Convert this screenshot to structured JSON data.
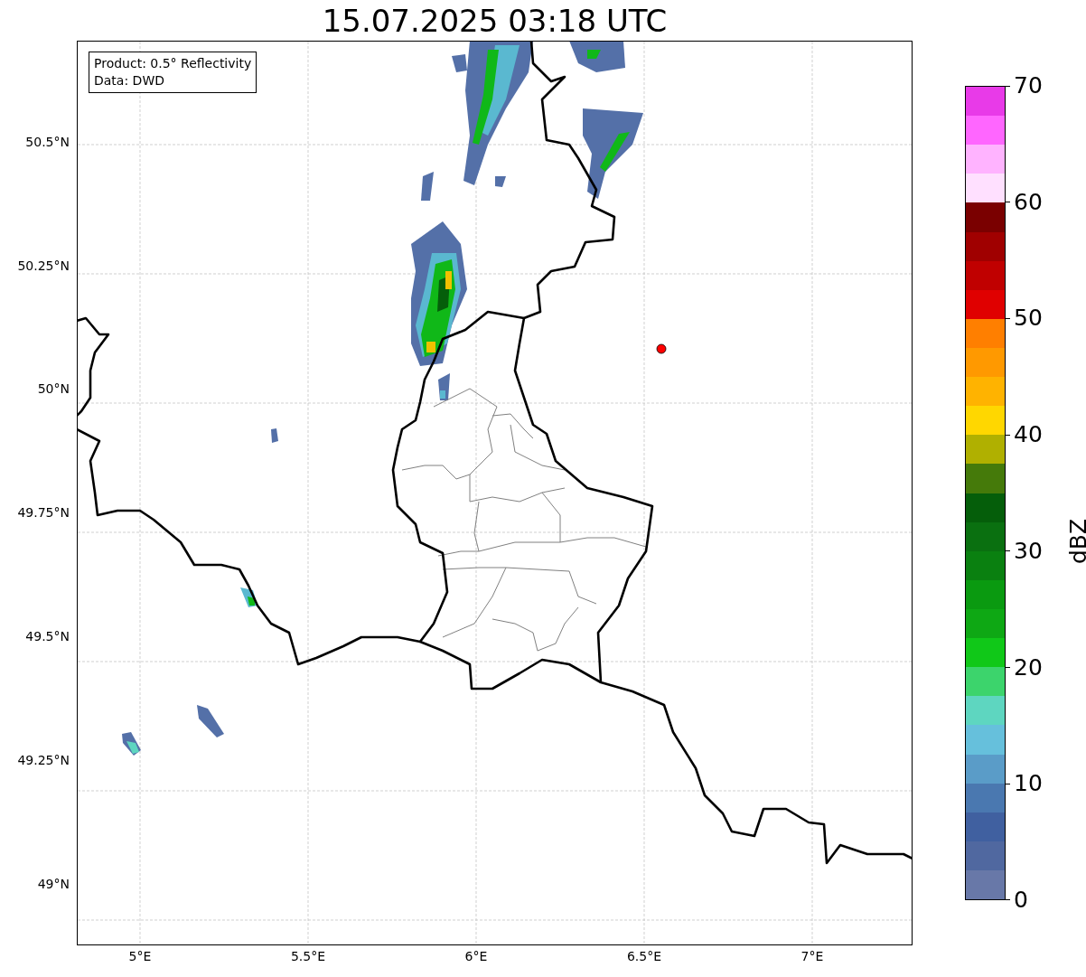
{
  "title": "15.07.2025 03:18 UTC",
  "legend": [
    "Product: 0.5° Reflectivity",
    "Data: DWD"
  ],
  "lat_labels": [
    "50.5°N",
    "50.25°N",
    "50°N",
    "49.75°N",
    "49.5°N",
    "49.25°N",
    "49°N"
  ],
  "lon_labels": [
    "5°E",
    "5.5°E",
    "6°E",
    "6.5°E",
    "7°E"
  ],
  "colorbar": {
    "label": "dBZ",
    "ticks": [
      "70",
      "60",
      "50",
      "40",
      "30",
      "20",
      "10",
      "0"
    ],
    "segments": [
      {
        "color": "#e83ae8"
      },
      {
        "color": "#ff66ff"
      },
      {
        "color": "#ffb3ff"
      },
      {
        "color": "#ffe0ff"
      },
      {
        "color": "#7a0000"
      },
      {
        "color": "#a00000"
      },
      {
        "color": "#c00000"
      },
      {
        "color": "#e00000"
      },
      {
        "color": "#ff7f00"
      },
      {
        "color": "#ff9900"
      },
      {
        "color": "#ffb300"
      },
      {
        "color": "#ffd700"
      },
      {
        "color": "#b0b000"
      },
      {
        "color": "#457a0a"
      },
      {
        "color": "#055e0a"
      },
      {
        "color": "#0a7010"
      },
      {
        "color": "#0a8010"
      },
      {
        "color": "#0a9a10"
      },
      {
        "color": "#0ea814"
      },
      {
        "color": "#10c818"
      },
      {
        "color": "#3cd46c"
      },
      {
        "color": "#5ed6c0"
      },
      {
        "color": "#66c0dc"
      },
      {
        "color": "#5a9cc8"
      },
      {
        "color": "#4a78b0"
      },
      {
        "color": "#4060a0"
      },
      {
        "color": "#5068a0"
      },
      {
        "color": "#6878a8"
      }
    ]
  }
}
